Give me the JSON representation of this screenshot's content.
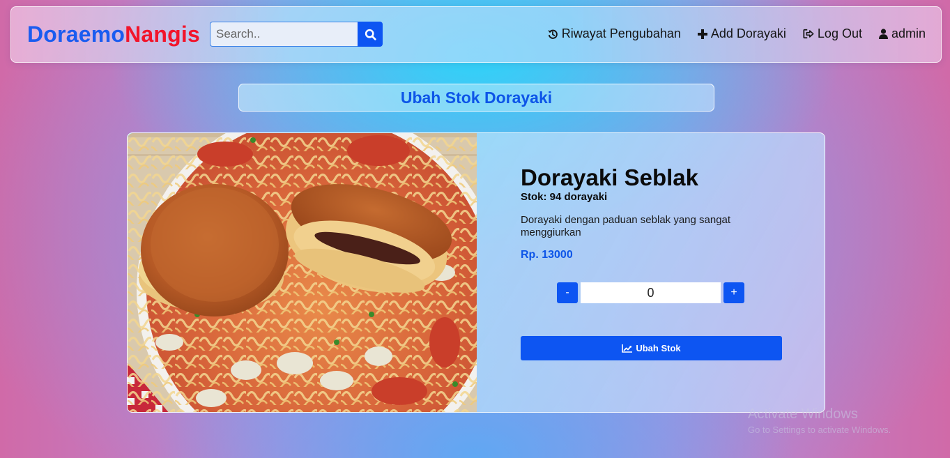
{
  "navbar": {
    "brand_part1": "Doraemo",
    "brand_part2": "Nangis",
    "search_placeholder": "Search..",
    "links": [
      {
        "label": "Riwayat Pengubahan",
        "icon": "history-icon"
      },
      {
        "label": "Add Dorayaki",
        "icon": "plus-icon"
      },
      {
        "label": "Log Out",
        "icon": "sign-out-icon"
      },
      {
        "label": "admin",
        "icon": "user-icon"
      }
    ]
  },
  "page": {
    "title": "Ubah Stok Dorayaki"
  },
  "product": {
    "name": "Dorayaki Seblak",
    "stock_text": "Stok: 94 dorayaki",
    "description": "Dorayaki dengan paduan seblak yang sangat menggiurkan",
    "price": "Rp. 13000",
    "image_icon": "dorayaki-seblak-photo",
    "quantity": {
      "minus_label": "-",
      "value": "0",
      "plus_label": "+"
    },
    "submit_label": "Ubah Stok",
    "submit_icon": "line-chart-icon"
  },
  "watermark": {
    "line1": "Activate Windows",
    "line2": "Go to Settings to activate Windows."
  },
  "colors": {
    "brand_blue": "#1a5cf0",
    "brand_red": "#f2142b",
    "primary_button": "#0d55f2",
    "price_text": "#0d55e8"
  }
}
